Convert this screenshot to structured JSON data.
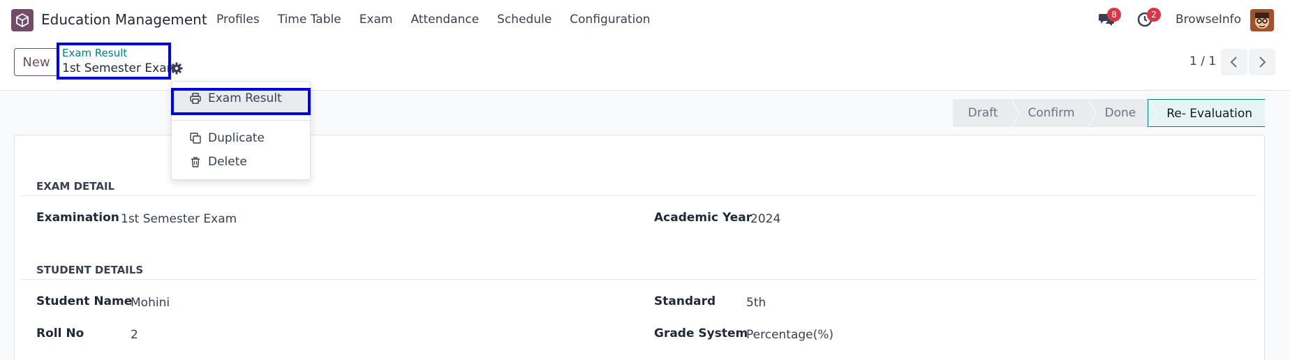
{
  "navbar": {
    "app_title": "Education Management",
    "menu": [
      "Profiles",
      "Time Table",
      "Exam",
      "Attendance",
      "Schedule",
      "Configuration"
    ],
    "messages_count": "8",
    "activities_count": "2",
    "user_name": "BrowseInfo"
  },
  "control": {
    "new_label": "New",
    "breadcrumb_parent": "Exam Result",
    "breadcrumb_current": "1st Semester Exam",
    "pager_value": "1 / 1"
  },
  "status_stages": [
    "Draft",
    "Confirm",
    "Done",
    "Re- Evaluation"
  ],
  "status_active": "Re- Evaluation",
  "action_menu": {
    "print_item": "Exam Result",
    "duplicate": "Duplicate",
    "delete": "Delete"
  },
  "exam_detail": {
    "title": "EXAM DETAIL",
    "examination_label": "Examination",
    "examination_value": "1st Semester Exam",
    "academic_year_label": "Academic Year",
    "academic_year_value": "2024"
  },
  "student_details": {
    "title": "STUDENT DETAILS",
    "student_name_label": "Student Name",
    "student_name_value": "Mohini",
    "standard_label": "Standard",
    "standard_value": "5th",
    "roll_no_label": "Roll No",
    "roll_no_value": "2",
    "grade_system_label": "Grade System",
    "grade_system_value": "Percentage(%)"
  },
  "colors": {
    "brand": "#714B67",
    "link": "#017e84",
    "badge": "#dc3545",
    "highlight_box": "#0000e6"
  }
}
